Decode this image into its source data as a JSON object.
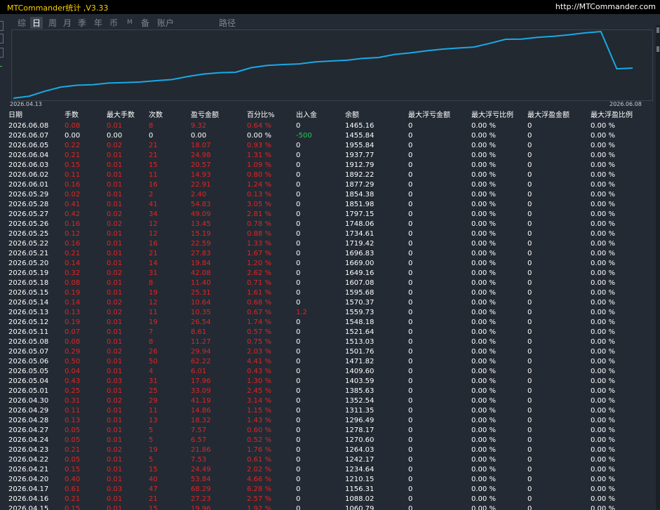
{
  "app": {
    "title": "MTCommander统计 ,V3.33",
    "url": "http://MTCommander.com"
  },
  "tabs": [
    {
      "label": "综",
      "selected": false
    },
    {
      "label": "日",
      "selected": true
    },
    {
      "label": "周",
      "selected": false
    },
    {
      "label": "月",
      "selected": false
    },
    {
      "label": "季",
      "selected": false
    },
    {
      "label": "年",
      "selected": false
    },
    {
      "label": "币",
      "selected": false
    },
    {
      "label": "M",
      "selected": false
    },
    {
      "label": "备",
      "selected": false
    },
    {
      "label": "账户",
      "selected": false
    },
    {
      "label": "路径",
      "selected": false
    }
  ],
  "chart": {
    "start_label": "2026.04.13",
    "end_label": "2026.06.08",
    "line_color": "#1aa9e6"
  },
  "colors": {
    "loss": "#e32424",
    "neutral": "#ffffff",
    "deposit": "#22cc55"
  },
  "columns": [
    "日期",
    "手数",
    "最大手数",
    "次数",
    "盈亏金额",
    "百分比%",
    "出入金",
    "余额",
    "最大浮亏金额",
    "最大浮亏比例",
    "最大浮盈金额",
    "最大浮盈比例"
  ],
  "rows": [
    [
      "2026.06.08",
      "0.08",
      "0.01",
      "8",
      "9.32",
      "0.64 %",
      "0",
      "1465.16",
      "0",
      "0.00 %",
      "0",
      "0.00 %"
    ],
    [
      "2026.06.07",
      "0.00",
      "0.00",
      "0",
      "0.00",
      "0.00 %",
      "-500",
      "1455.84",
      "0",
      "0.00 %",
      "0",
      "0.00 %"
    ],
    [
      "2026.06.05",
      "0.22",
      "0.02",
      "21",
      "18.07",
      "0.93 %",
      "0",
      "1955.84",
      "0",
      "0.00 %",
      "0",
      "0.00 %"
    ],
    [
      "2026.06.04",
      "0.21",
      "0.01",
      "21",
      "24.98",
      "1.31 %",
      "0",
      "1937.77",
      "0",
      "0.00 %",
      "0",
      "0.00 %"
    ],
    [
      "2026.06.03",
      "0.15",
      "0.01",
      "15",
      "20.57",
      "1.09 %",
      "0",
      "1912.79",
      "0",
      "0.00 %",
      "0",
      "0.00 %"
    ],
    [
      "2026.06.02",
      "0.11",
      "0.01",
      "11",
      "14.93",
      "0.80 %",
      "0",
      "1892.22",
      "0",
      "0.00 %",
      "0",
      "0.00 %"
    ],
    [
      "2026.06.01",
      "0.16",
      "0.01",
      "16",
      "22.91",
      "1.24 %",
      "0",
      "1877.29",
      "0",
      "0.00 %",
      "0",
      "0.00 %"
    ],
    [
      "2026.05.29",
      "0.02",
      "0.01",
      "2",
      "2.40",
      "0.13 %",
      "0",
      "1854.38",
      "0",
      "0.00 %",
      "0",
      "0.00 %"
    ],
    [
      "2026.05.28",
      "0.41",
      "0.01",
      "41",
      "54.83",
      "3.05 %",
      "0",
      "1851.98",
      "0",
      "0.00 %",
      "0",
      "0.00 %"
    ],
    [
      "2026.05.27",
      "0.42",
      "0.02",
      "34",
      "49.09",
      "2.81 %",
      "0",
      "1797.15",
      "0",
      "0.00 %",
      "0",
      "0.00 %"
    ],
    [
      "2026.05.26",
      "0.16",
      "0.02",
      "12",
      "13.45",
      "0.78 %",
      "0",
      "1748.06",
      "0",
      "0.00 %",
      "0",
      "0.00 %"
    ],
    [
      "2026.05.25",
      "0.12",
      "0.01",
      "12",
      "15.19",
      "0.88 %",
      "0",
      "1734.61",
      "0",
      "0.00 %",
      "0",
      "0.00 %"
    ],
    [
      "2026.05.22",
      "0.16",
      "0.01",
      "16",
      "22.59",
      "1.33 %",
      "0",
      "1719.42",
      "0",
      "0.00 %",
      "0",
      "0.00 %"
    ],
    [
      "2026.05.21",
      "0.21",
      "0.01",
      "21",
      "27.83",
      "1.67 %",
      "0",
      "1696.83",
      "0",
      "0.00 %",
      "0",
      "0.00 %"
    ],
    [
      "2026.05.20",
      "0.14",
      "0.01",
      "14",
      "19.84",
      "1.20 %",
      "0",
      "1669.00",
      "0",
      "0.00 %",
      "0",
      "0.00 %"
    ],
    [
      "2026.05.19",
      "0.32",
      "0.02",
      "31",
      "42.08",
      "2.62 %",
      "0",
      "1649.16",
      "0",
      "0.00 %",
      "0",
      "0.00 %"
    ],
    [
      "2026.05.18",
      "0.08",
      "0.01",
      "8",
      "11.40",
      "0.71 %",
      "0",
      "1607.08",
      "0",
      "0.00 %",
      "0",
      "0.00 %"
    ],
    [
      "2026.05.15",
      "0.19",
      "0.01",
      "19",
      "25.31",
      "1.61 %",
      "0",
      "1595.68",
      "0",
      "0.00 %",
      "0",
      "0.00 %"
    ],
    [
      "2026.05.14",
      "0.14",
      "0.02",
      "12",
      "10.64",
      "0.68 %",
      "0",
      "1570.37",
      "0",
      "0.00 %",
      "0",
      "0.00 %"
    ],
    [
      "2026.05.13",
      "0.13",
      "0.02",
      "11",
      "10.35",
      "0.67 %",
      "1.2",
      "1559.73",
      "0",
      "0.00 %",
      "0",
      "0.00 %"
    ],
    [
      "2026.05.12",
      "0.19",
      "0.01",
      "19",
      "26.54",
      "1.74 %",
      "0",
      "1548.18",
      "0",
      "0.00 %",
      "0",
      "0.00 %"
    ],
    [
      "2026.05.11",
      "0.07",
      "0.01",
      "7",
      "8.61",
      "0.57 %",
      "0",
      "1521.64",
      "0",
      "0.00 %",
      "0",
      "0.00 %"
    ],
    [
      "2026.05.08",
      "0.08",
      "0.01",
      "8",
      "11.27",
      "0.75 %",
      "0",
      "1513.03",
      "0",
      "0.00 %",
      "0",
      "0.00 %"
    ],
    [
      "2026.05.07",
      "0.29",
      "0.02",
      "26",
      "29.94",
      "2.03 %",
      "0",
      "1501.76",
      "0",
      "0.00 %",
      "0",
      "0.00 %"
    ],
    [
      "2026.05.06",
      "0.50",
      "0.01",
      "50",
      "62.22",
      "4.41 %",
      "0",
      "1471.82",
      "0",
      "0.00 %",
      "0",
      "0.00 %"
    ],
    [
      "2026.05.05",
      "0.04",
      "0.01",
      "4",
      "6.01",
      "0.43 %",
      "0",
      "1409.60",
      "0",
      "0.00 %",
      "0",
      "0.00 %"
    ],
    [
      "2026.05.04",
      "0.43",
      "0.03",
      "31",
      "17.96",
      "1.30 %",
      "0",
      "1403.59",
      "0",
      "0.00 %",
      "0",
      "0.00 %"
    ],
    [
      "2026.05.01",
      "0.25",
      "0.01",
      "25",
      "33.09",
      "2.45 %",
      "0",
      "1385.63",
      "0",
      "0.00 %",
      "0",
      "0.00 %"
    ],
    [
      "2026.04.30",
      "0.31",
      "0.02",
      "29",
      "41.19",
      "3.14 %",
      "0",
      "1352.54",
      "0",
      "0.00 %",
      "0",
      "0.00 %"
    ],
    [
      "2026.04.29",
      "0.11",
      "0.01",
      "11",
      "14.86",
      "1.15 %",
      "0",
      "1311.35",
      "0",
      "0.00 %",
      "0",
      "0.00 %"
    ],
    [
      "2026.04.28",
      "0.13",
      "0.01",
      "13",
      "18.32",
      "1.43 %",
      "0",
      "1296.49",
      "0",
      "0.00 %",
      "0",
      "0.00 %"
    ],
    [
      "2026.04.27",
      "0.05",
      "0.01",
      "5",
      "7.57",
      "0.60 %",
      "0",
      "1278.17",
      "0",
      "0.00 %",
      "0",
      "0.00 %"
    ],
    [
      "2026.04.24",
      "0.05",
      "0.01",
      "5",
      "6.57",
      "0.52 %",
      "0",
      "1270.60",
      "0",
      "0.00 %",
      "0",
      "0.00 %"
    ],
    [
      "2026.04.23",
      "0.21",
      "0.02",
      "19",
      "21.86",
      "1.76 %",
      "0",
      "1264.03",
      "0",
      "0.00 %",
      "0",
      "0.00 %"
    ],
    [
      "2026.04.22",
      "0.05",
      "0.01",
      "5",
      "7.53",
      "0.61 %",
      "0",
      "1242.17",
      "0",
      "0.00 %",
      "0",
      "0.00 %"
    ],
    [
      "2026.04.21",
      "0.15",
      "0.01",
      "15",
      "24.49",
      "2.02 %",
      "0",
      "1234.64",
      "0",
      "0.00 %",
      "0",
      "0.00 %"
    ],
    [
      "2026.04.20",
      "0.40",
      "0.01",
      "40",
      "53.84",
      "4.66 %",
      "0",
      "1210.15",
      "0",
      "0.00 %",
      "0",
      "0.00 %"
    ],
    [
      "2026.04.17",
      "0.61",
      "0.03",
      "47",
      "68.29",
      "6.28 %",
      "0",
      "1156.31",
      "0",
      "0.00 %",
      "0",
      "0.00 %"
    ],
    [
      "2026.04.16",
      "0.21",
      "0.01",
      "21",
      "27.23",
      "2.57 %",
      "0",
      "1088.02",
      "0",
      "0.00 %",
      "0",
      "0.00 %"
    ],
    [
      "2026.04.15",
      "0.15",
      "0.01",
      "15",
      "19.96",
      "1.92 %",
      "0",
      "1060.79",
      "0",
      "0.00 %",
      "0",
      "0.00 %"
    ]
  ]
}
